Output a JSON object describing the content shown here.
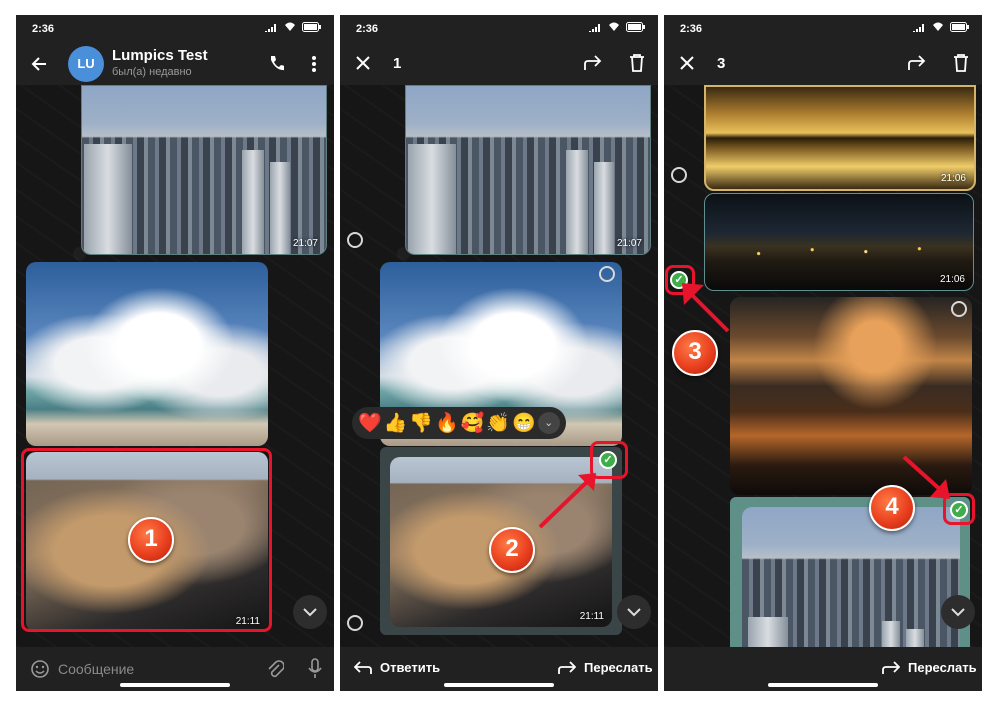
{
  "statusbar": {
    "time": "2:36"
  },
  "screen1": {
    "contact_name": "Lumpics Test",
    "contact_status": "был(а) недавно",
    "avatar_initials": "LU",
    "photo1_time": "21:07",
    "photo3_time": "21:11",
    "input_placeholder": "Сообщение",
    "step_badge": "1"
  },
  "screen2": {
    "selected_count": "1",
    "photo1_time": "21:07",
    "photo3_time": "21:11",
    "reactions": [
      "❤️",
      "👍",
      "👎",
      "🔥",
      "🥰",
      "👏",
      "😁"
    ],
    "reply_label": "Ответить",
    "forward_label": "Переслать",
    "step_badge": "2"
  },
  "screen3": {
    "selected_count": "3",
    "photo1_time": "21:06",
    "photo2_time": "21:06",
    "forward_label": "Переслать",
    "step_badge_a": "3",
    "step_badge_b": "4"
  },
  "icons": {
    "back": "arrow-left-icon",
    "call": "phone-icon",
    "menu": "more-vertical-icon",
    "close": "close-icon",
    "forward": "forward-icon",
    "delete": "trash-icon",
    "emoji": "smile-icon",
    "attach": "paperclip-icon",
    "mic": "microphone-icon",
    "scroll_down": "chevron-down-icon",
    "reply": "reply-icon"
  },
  "colors": {
    "highlight_red": "#e8142b",
    "check_green": "#3fae49",
    "badge_orange": "#e9401f"
  }
}
